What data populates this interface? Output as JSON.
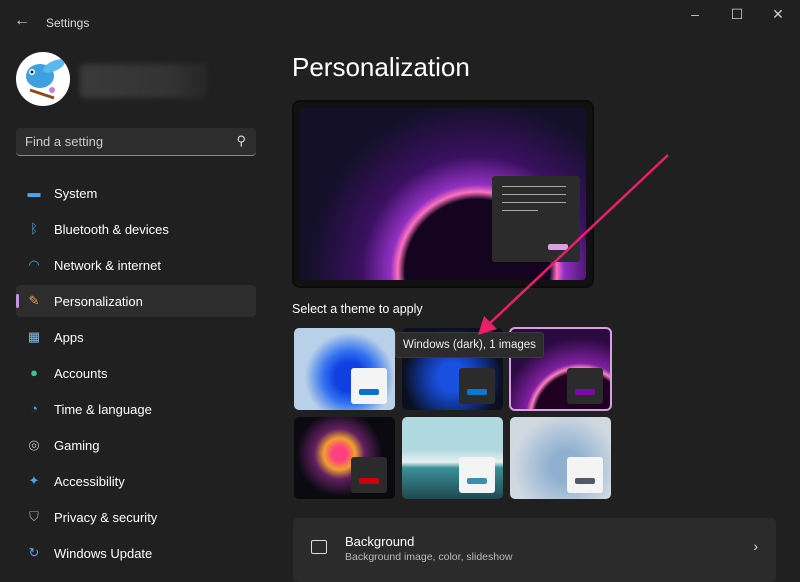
{
  "window": {
    "title": "Settings"
  },
  "search": {
    "placeholder": "Find a setting"
  },
  "sidebar": {
    "items": [
      {
        "label": "System",
        "icon": "monitor-icon"
      },
      {
        "label": "Bluetooth & devices",
        "icon": "bluetooth-icon"
      },
      {
        "label": "Network & internet",
        "icon": "wifi-icon"
      },
      {
        "label": "Personalization",
        "icon": "brush-icon",
        "selected": true
      },
      {
        "label": "Apps",
        "icon": "apps-icon"
      },
      {
        "label": "Accounts",
        "icon": "person-icon"
      },
      {
        "label": "Time & language",
        "icon": "clock-globe-icon"
      },
      {
        "label": "Gaming",
        "icon": "gamepad-icon"
      },
      {
        "label": "Accessibility",
        "icon": "accessibility-icon"
      },
      {
        "label": "Privacy & security",
        "icon": "shield-icon"
      },
      {
        "label": "Windows Update",
        "icon": "update-icon"
      }
    ]
  },
  "main": {
    "title": "Personalization",
    "themes_label": "Select a theme to apply",
    "tooltip": "Windows (dark), 1 images",
    "themes": [
      {
        "accent": "#0a6fd0",
        "selected": false
      },
      {
        "accent": "#0a78d0",
        "selected": false
      },
      {
        "accent": "#7a0aa8",
        "selected": true
      },
      {
        "accent": "#d0000a",
        "selected": false
      },
      {
        "accent": "#3a90a8",
        "selected": false
      },
      {
        "accent": "#505a66",
        "selected": false
      }
    ],
    "background_card": {
      "title": "Background",
      "subtitle": "Background image, color, slideshow"
    }
  },
  "colors": {
    "accent": "#c890e0",
    "annotation_arrow": "#e8206a"
  }
}
